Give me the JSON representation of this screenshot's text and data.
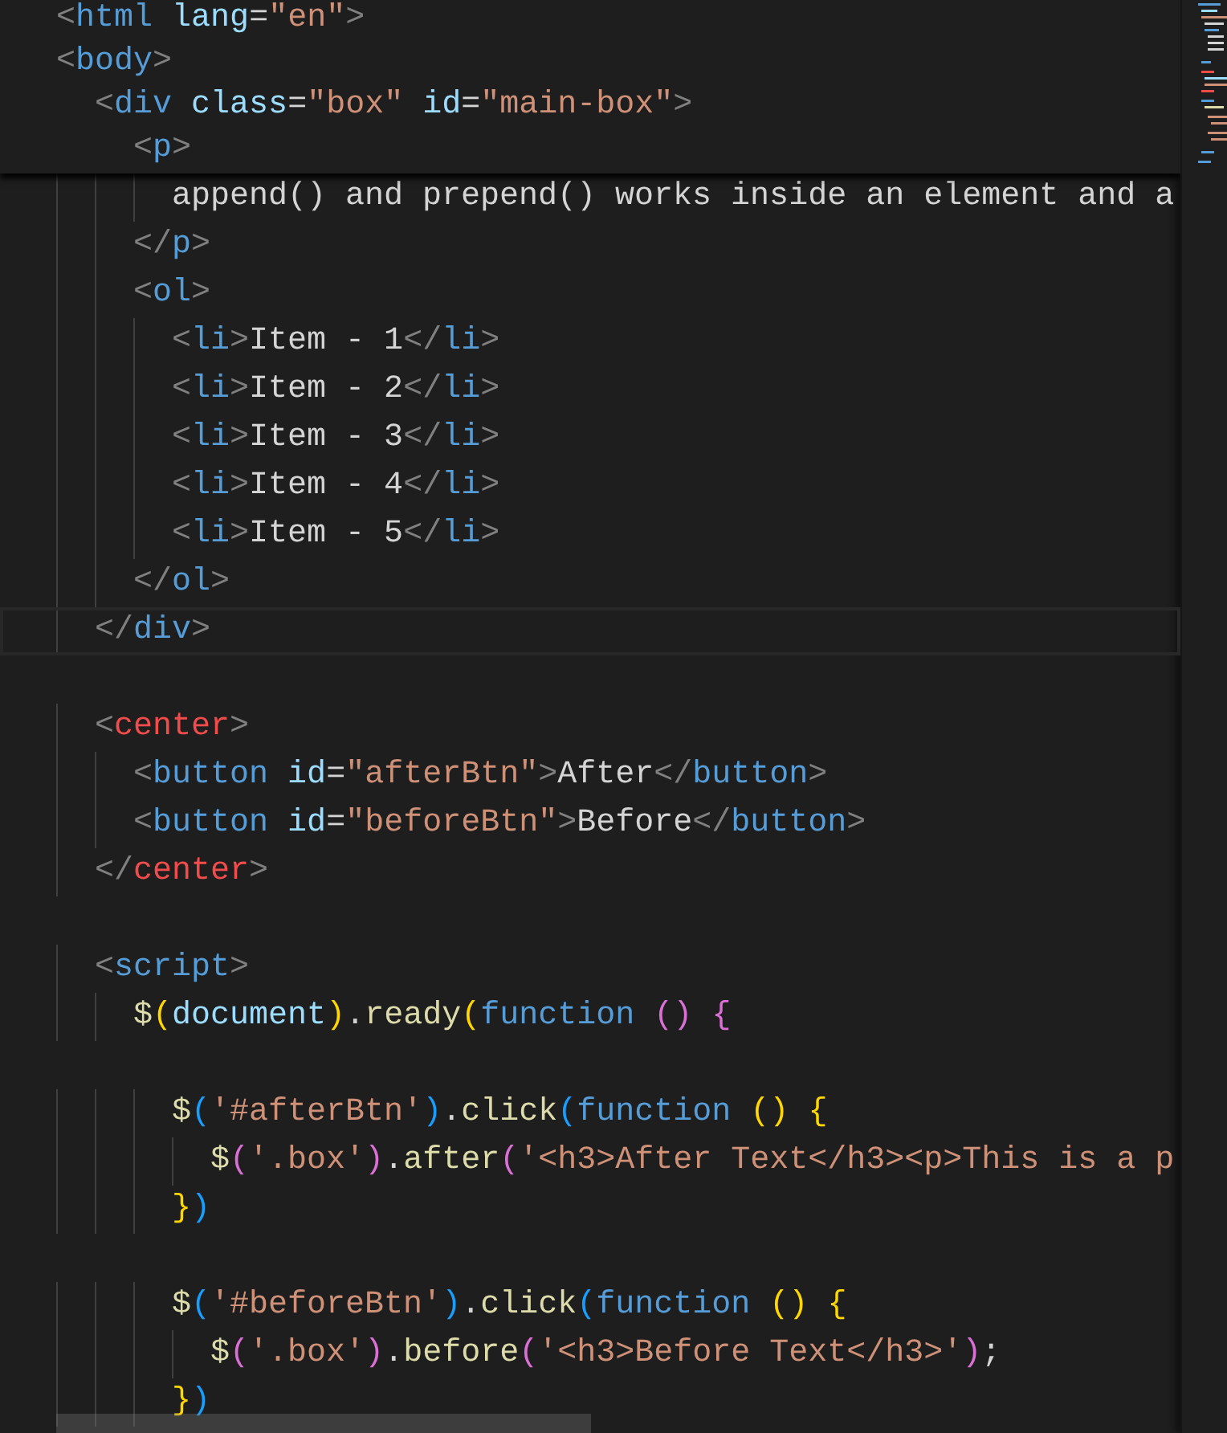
{
  "sticky_scroll": [
    {
      "kind": "html",
      "text": "<html lang=\"en\">"
    },
    {
      "kind": "html",
      "text": "<body>"
    },
    {
      "kind": "html",
      "text": "  <div class=\"box\" id=\"main-box\">"
    },
    {
      "kind": "html",
      "text": "    <p>"
    }
  ],
  "lines": [
    {
      "current": false,
      "kind": "text",
      "text": "      append() and prepend() works inside an element and a"
    },
    {
      "current": false,
      "kind": "html",
      "text": "    </p>"
    },
    {
      "current": false,
      "kind": "html",
      "text": "    <ol>"
    },
    {
      "current": false,
      "kind": "html",
      "text": "      <li>Item - 1</li>"
    },
    {
      "current": false,
      "kind": "html",
      "text": "      <li>Item - 2</li>"
    },
    {
      "current": false,
      "kind": "html",
      "text": "      <li>Item - 3</li>"
    },
    {
      "current": false,
      "kind": "html",
      "text": "      <li>Item - 4</li>"
    },
    {
      "current": false,
      "kind": "html",
      "text": "      <li>Item - 5</li>"
    },
    {
      "current": false,
      "kind": "html",
      "text": "    </ol>"
    },
    {
      "current": true,
      "kind": "html",
      "text": "  </div>"
    },
    {
      "current": false
    },
    {
      "current": false,
      "kind": "deprecated",
      "text": "  <center>"
    },
    {
      "current": false,
      "kind": "html",
      "text": "    <button id=\"afterBtn\">After</button>"
    },
    {
      "current": false,
      "kind": "html",
      "text": "    <button id=\"beforeBtn\">Before</button>"
    },
    {
      "current": false,
      "kind": "deprecated",
      "text": "  </center>"
    },
    {
      "current": false
    },
    {
      "current": false,
      "kind": "html",
      "text": "  <script>"
    },
    {
      "current": false,
      "kind": "js",
      "text": "    $(document).ready(function () {"
    },
    {
      "current": false
    },
    {
      "current": false,
      "kind": "js",
      "text": "      $('#afterBtn').click(function () {"
    },
    {
      "current": false,
      "kind": "js",
      "text": "        $('.box').after('<h3>After Text</h3><p>This is a p"
    },
    {
      "current": false,
      "kind": "js",
      "text": "      })"
    },
    {
      "current": false
    },
    {
      "current": false,
      "kind": "js",
      "text": "      $('#beforeBtn').click(function () {"
    },
    {
      "current": false,
      "kind": "js",
      "text": "        $('.box').before('<h3>Before Text</h3>');"
    },
    {
      "current": false,
      "kind": "js",
      "text": "      })"
    }
  ]
}
